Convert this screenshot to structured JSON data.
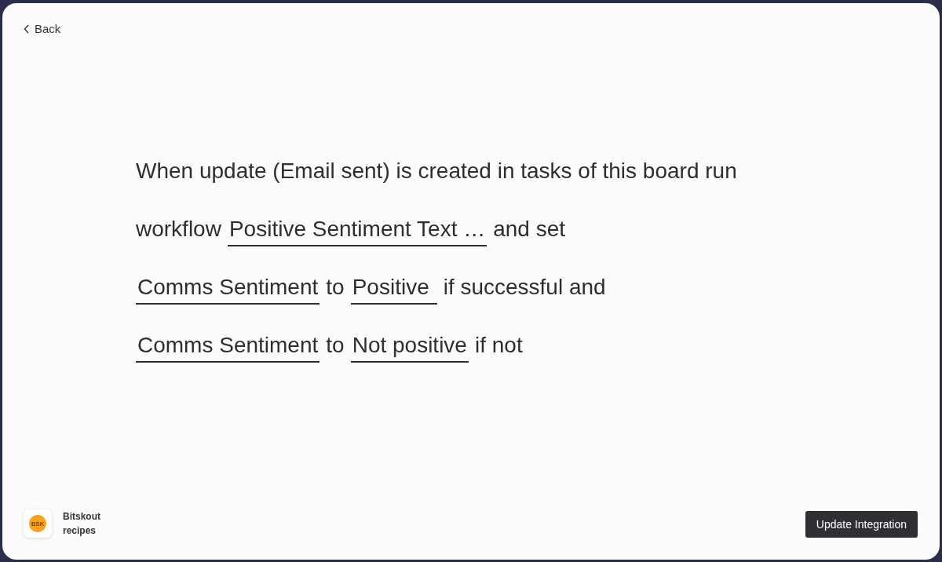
{
  "back_link": {
    "label": "Back"
  },
  "recipe_lines": [
    {
      "segments": [
        {
          "kind": "text",
          "text": "When update (Email sent) is created in tasks of this board run"
        }
      ]
    },
    {
      "segments": [
        {
          "kind": "text",
          "text": "workflow"
        },
        {
          "kind": "field",
          "value": "Positive Sentiment Text …"
        },
        {
          "kind": "text",
          "text": "and set"
        }
      ]
    },
    {
      "segments": [
        {
          "kind": "field",
          "value": "Comms Sentiment"
        },
        {
          "kind": "text",
          "text": "to"
        },
        {
          "kind": "field",
          "value": "Positive"
        },
        {
          "kind": "text",
          "text": "if successful and"
        }
      ]
    },
    {
      "segments": [
        {
          "kind": "field",
          "value": "Comms Sentiment"
        },
        {
          "kind": "text",
          "text": "to"
        },
        {
          "kind": "field",
          "value": "Not positive"
        },
        {
          "kind": "text",
          "text": "if not"
        }
      ]
    }
  ],
  "brand": {
    "logo_text": "BSK",
    "name": "Bitskout recipes"
  },
  "primary_button": {
    "label": "Update Integration"
  }
}
